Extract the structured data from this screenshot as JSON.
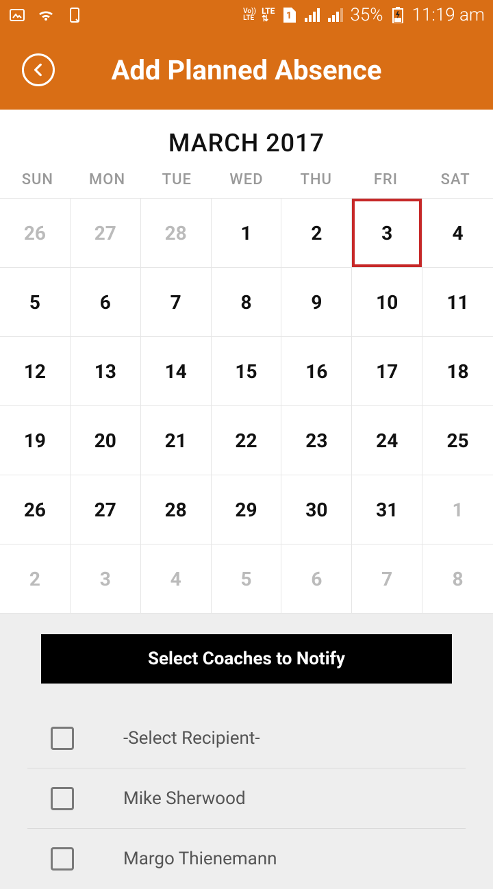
{
  "status": {
    "battery": "35%",
    "time": "11:19 am",
    "vo_label": "Vo))",
    "lte_label": "LTE",
    "sim_label": "1"
  },
  "header": {
    "title": "Add Planned Absence"
  },
  "calendar": {
    "month_label": "MARCH 2017",
    "dow": [
      "SUN",
      "MON",
      "TUE",
      "WED",
      "THU",
      "FRI",
      "SAT"
    ],
    "selected_day": "3",
    "weeks": [
      [
        {
          "d": "26",
          "off": true
        },
        {
          "d": "27",
          "off": true
        },
        {
          "d": "28",
          "off": true
        },
        {
          "d": "1"
        },
        {
          "d": "2"
        },
        {
          "d": "3",
          "selected": true
        },
        {
          "d": "4"
        }
      ],
      [
        {
          "d": "5"
        },
        {
          "d": "6"
        },
        {
          "d": "7"
        },
        {
          "d": "8"
        },
        {
          "d": "9"
        },
        {
          "d": "10"
        },
        {
          "d": "11"
        }
      ],
      [
        {
          "d": "12"
        },
        {
          "d": "13"
        },
        {
          "d": "14"
        },
        {
          "d": "15"
        },
        {
          "d": "16"
        },
        {
          "d": "17"
        },
        {
          "d": "18"
        }
      ],
      [
        {
          "d": "19"
        },
        {
          "d": "20"
        },
        {
          "d": "21"
        },
        {
          "d": "22"
        },
        {
          "d": "23"
        },
        {
          "d": "24"
        },
        {
          "d": "25"
        }
      ],
      [
        {
          "d": "26"
        },
        {
          "d": "27"
        },
        {
          "d": "28"
        },
        {
          "d": "29"
        },
        {
          "d": "30"
        },
        {
          "d": "31"
        },
        {
          "d": "1",
          "off": true
        }
      ],
      [
        {
          "d": "2",
          "off": true
        },
        {
          "d": "3",
          "off": true
        },
        {
          "d": "4",
          "off": true
        },
        {
          "d": "5",
          "off": true
        },
        {
          "d": "6",
          "off": true
        },
        {
          "d": "7",
          "off": true
        },
        {
          "d": "8",
          "off": true
        }
      ]
    ]
  },
  "notify": {
    "header": "Select Coaches to Notify",
    "recipients": [
      {
        "label": "-Select Recipient-"
      },
      {
        "label": "Mike Sherwood"
      },
      {
        "label": "Margo Thienemann"
      }
    ]
  }
}
